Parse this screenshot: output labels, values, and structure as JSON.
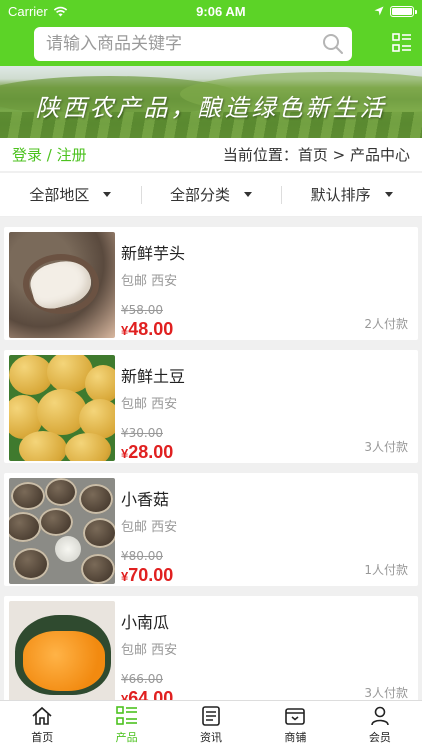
{
  "status": {
    "carrier": "Carrier",
    "time": "9:06 AM",
    "battery_level": 1.0
  },
  "header": {
    "search_placeholder": "请输入商品关键字"
  },
  "banner": {
    "title": "陕西农产品，酿造绿色新生活"
  },
  "info": {
    "login": "登录 / 注册",
    "breadcrumb": "当前位置：首页 > 产品中心"
  },
  "filters": [
    {
      "label": "全部地区"
    },
    {
      "label": "全部分类"
    },
    {
      "label": "默认排序"
    }
  ],
  "products": [
    {
      "name": "新鲜芋头",
      "tag": "包邮 西安",
      "old_price": "¥58.00",
      "currency": "¥",
      "price": "48.00",
      "sold": "2人付款"
    },
    {
      "name": "新鲜土豆",
      "tag": "包邮 西安",
      "old_price": "¥30.00",
      "currency": "¥",
      "price": "28.00",
      "sold": "3人付款"
    },
    {
      "name": "小香菇",
      "tag": "包邮 西安",
      "old_price": "¥80.00",
      "currency": "¥",
      "price": "70.00",
      "sold": "1人付款"
    },
    {
      "name": "小南瓜",
      "tag": "包邮 西安",
      "old_price": "¥66.00",
      "currency": "¥",
      "price": "64.00",
      "sold": "3人付款"
    }
  ],
  "tabs": [
    {
      "label": "首页",
      "icon": "home-icon"
    },
    {
      "label": "产品",
      "icon": "grid-list-icon"
    },
    {
      "label": "资讯",
      "icon": "news-icon"
    },
    {
      "label": "商铺",
      "icon": "store-icon"
    },
    {
      "label": "会员",
      "icon": "user-icon"
    }
  ],
  "colors": {
    "brand_green": "#5cd327",
    "price_red": "#e02020",
    "active_tab": "#4cc21f"
  }
}
